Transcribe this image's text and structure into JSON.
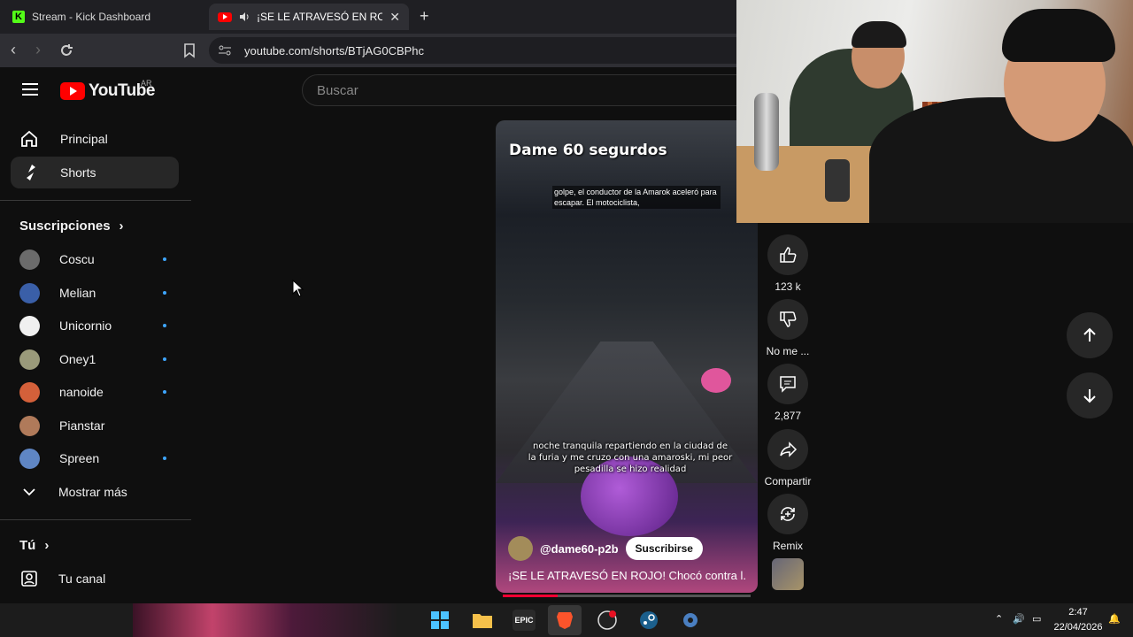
{
  "browser": {
    "tabs": [
      {
        "title": "Stream - Kick Dashboard",
        "favicon": "kick-icon"
      },
      {
        "title": "¡SE LE ATRAVESÓ EN ROJO! C",
        "favicon": "youtube-icon",
        "audio_icon": "speaker-icon",
        "active": true
      }
    ],
    "new_tab_label": "+",
    "url": "youtube.com/shorts/BTjAG0CBPhc"
  },
  "youtube": {
    "logo_text": "YouTube",
    "country_code": "AR",
    "search_placeholder": "Buscar",
    "nav": [
      {
        "label": "Principal",
        "icon": "home-icon"
      },
      {
        "label": "Shorts",
        "icon": "shorts-icon",
        "active": true
      }
    ],
    "subscriptions_title": "Suscripciones",
    "subscriptions": [
      {
        "name": "Coscu",
        "live": true,
        "color": "#6b6b6b"
      },
      {
        "name": "Melian",
        "live": true,
        "color": "#3a5fa8"
      },
      {
        "name": "Unicornio",
        "live": true,
        "color": "#f0f0f0"
      },
      {
        "name": "Oney1",
        "live": true,
        "color": "#9a9a7a"
      },
      {
        "name": "nanoide",
        "live": true,
        "color": "#d4603a"
      },
      {
        "name": "Pianstar",
        "live": false,
        "color": "#b07a5a"
      },
      {
        "name": "Spreen",
        "live": true,
        "color": "#5f86c4"
      }
    ],
    "show_more_label": "Mostrar más",
    "you_title": "Tú",
    "your_channel_label": "Tu canal"
  },
  "short": {
    "overlay_title": "Dame 60 segurdos",
    "caption_top": "golpe, el conductor de la Amarok aceleró para escapar. El motociclista,",
    "caption_bottom": "noche tranquila repartiendo en la ciudad de la furia y me cruzo con una amaroski, mi peor pesadilla se hizo realidad",
    "channel": "@dame60-p2b",
    "subscribe_label": "Suscribirse",
    "title": "¡SE LE ATRAVESÓ EN ROJO! Chocó contra l...",
    "progress": 0.22,
    "actions": {
      "like_count": "123 k",
      "dislike_label": "No me ...",
      "comments_count": "2,877",
      "share_label": "Compartir",
      "remix_label": "Remix"
    }
  },
  "taskbar": {
    "epic_label": "EPIC",
    "time": "2:47",
    "date": "22/04/2026"
  },
  "colors": {
    "youtube_red": "#ff0000",
    "background": "#0f0f0f",
    "live_dot": "#3ea6ff",
    "progress": "#ff0033"
  }
}
